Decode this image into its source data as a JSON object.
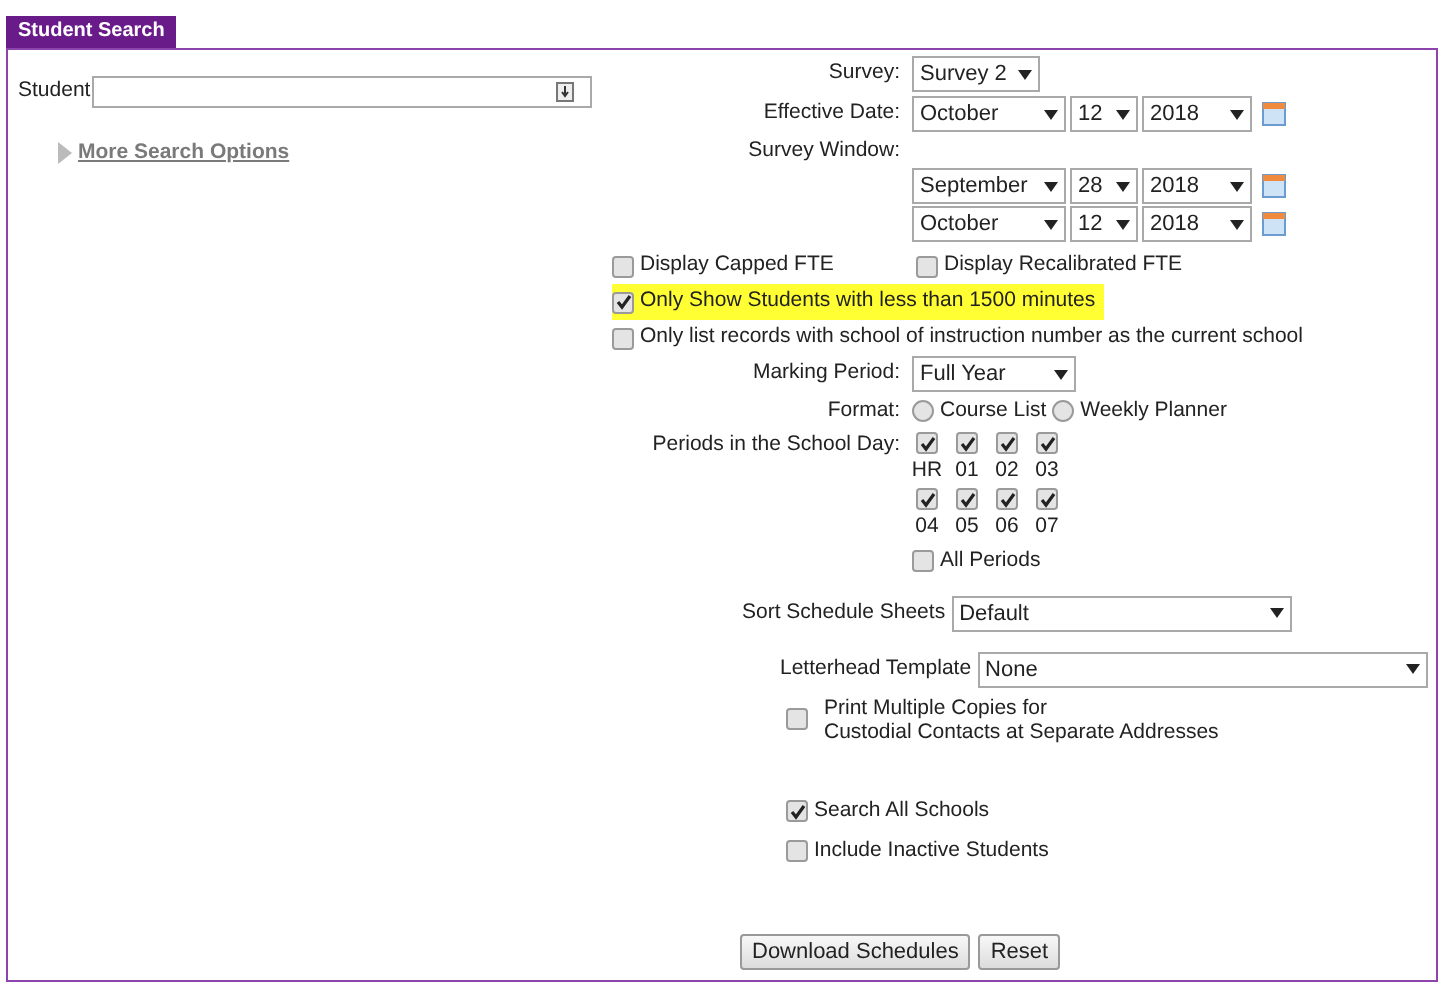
{
  "tab": {
    "title": "Student Search",
    "selected": true
  },
  "student": {
    "label": "Student"
  },
  "more_options": {
    "label": "More Search Options",
    "expanded": false
  },
  "survey": {
    "label": "Survey:",
    "value": "Survey 2"
  },
  "effective_date": {
    "label": "Effective Date:",
    "month": "October",
    "day": "12",
    "year": "2018"
  },
  "survey_window": {
    "label": "Survey Window:",
    "start": {
      "month": "September",
      "day": "28",
      "year": "2018"
    },
    "end": {
      "month": "October",
      "day": "12",
      "year": "2018"
    }
  },
  "fte_options": [
    {
      "label": "Display Capped FTE",
      "checked": false
    },
    {
      "label": "Display Recalibrated FTE",
      "checked": false
    }
  ],
  "filters": [
    {
      "label": "Only Show Students with less than 1500 minutes",
      "checked": true,
      "highlighted": true
    },
    {
      "label": "Only list records with school of instruction number as the current school",
      "checked": false,
      "highlighted": false
    }
  ],
  "marking_period": {
    "label": "Marking Period:",
    "value": "Full Year"
  },
  "format": {
    "label": "Format:",
    "options": [
      {
        "label": "Course List",
        "selected": false
      },
      {
        "label": "Weekly Planner",
        "selected": false
      }
    ]
  },
  "periods": {
    "label": "Periods in the School Day:",
    "items": [
      {
        "label": "HR",
        "checked": true
      },
      {
        "label": "01",
        "checked": true
      },
      {
        "label": "02",
        "checked": true
      },
      {
        "label": "03",
        "checked": true
      },
      {
        "label": "04",
        "checked": true
      },
      {
        "label": "05",
        "checked": true
      },
      {
        "label": "06",
        "checked": true
      },
      {
        "label": "07",
        "checked": true
      }
    ],
    "all": {
      "label": "All Periods",
      "checked": false
    }
  },
  "sort": {
    "label": "Sort Schedule Sheets",
    "value": "Default"
  },
  "letterhead": {
    "label": "Letterhead Template",
    "value": "None"
  },
  "print_copies": {
    "lines": [
      "Print Multiple Copies for",
      "Custodial Contacts at Separate Addresses"
    ],
    "checked": false
  },
  "school_options": [
    {
      "label": "Search All Schools",
      "checked": true
    },
    {
      "label": "Include Inactive Students",
      "checked": false
    }
  ],
  "buttons": [
    "Download Schedules",
    "Reset"
  ]
}
